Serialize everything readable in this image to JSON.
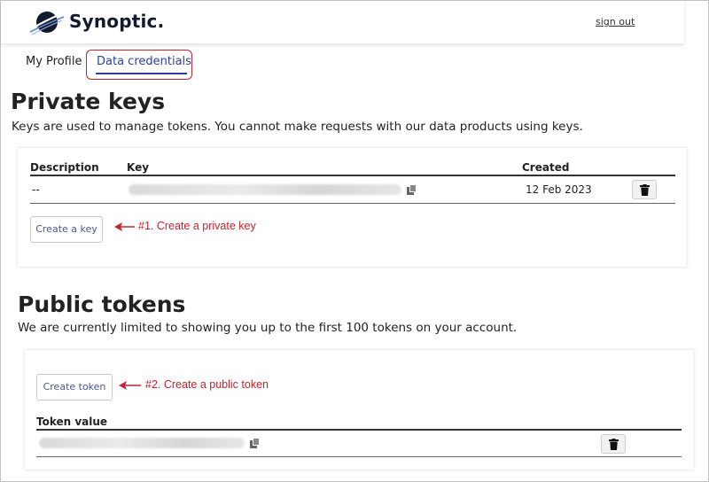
{
  "header": {
    "brand": "Synoptic.",
    "signout_label": "sign out"
  },
  "tabs": [
    {
      "label": "My Profile"
    },
    {
      "label": "Data credentials"
    }
  ],
  "private_keys": {
    "title": "Private keys",
    "description": "Keys are used to manage tokens. You cannot make requests with our data products using keys.",
    "columns": [
      "Description",
      "Key",
      "Created"
    ],
    "rows": [
      {
        "description": "--",
        "created": "12 Feb 2023"
      }
    ],
    "create_label": "Create a key",
    "annotation": "#1. Create a private key"
  },
  "public_tokens": {
    "title": "Public tokens",
    "description": "We are currently limited to showing you up to the first 100 tokens on your account.",
    "create_label": "Create token",
    "annotation": "#2. Create a public token",
    "columns": [
      "Token value"
    ]
  },
  "colors": {
    "accent": "#2c3fa6",
    "annotation": "#c8202c",
    "button_text": "#4a5596"
  },
  "icons": [
    "logo-icon",
    "copy-icon",
    "trash-icon",
    "arrow-left-icon"
  ]
}
